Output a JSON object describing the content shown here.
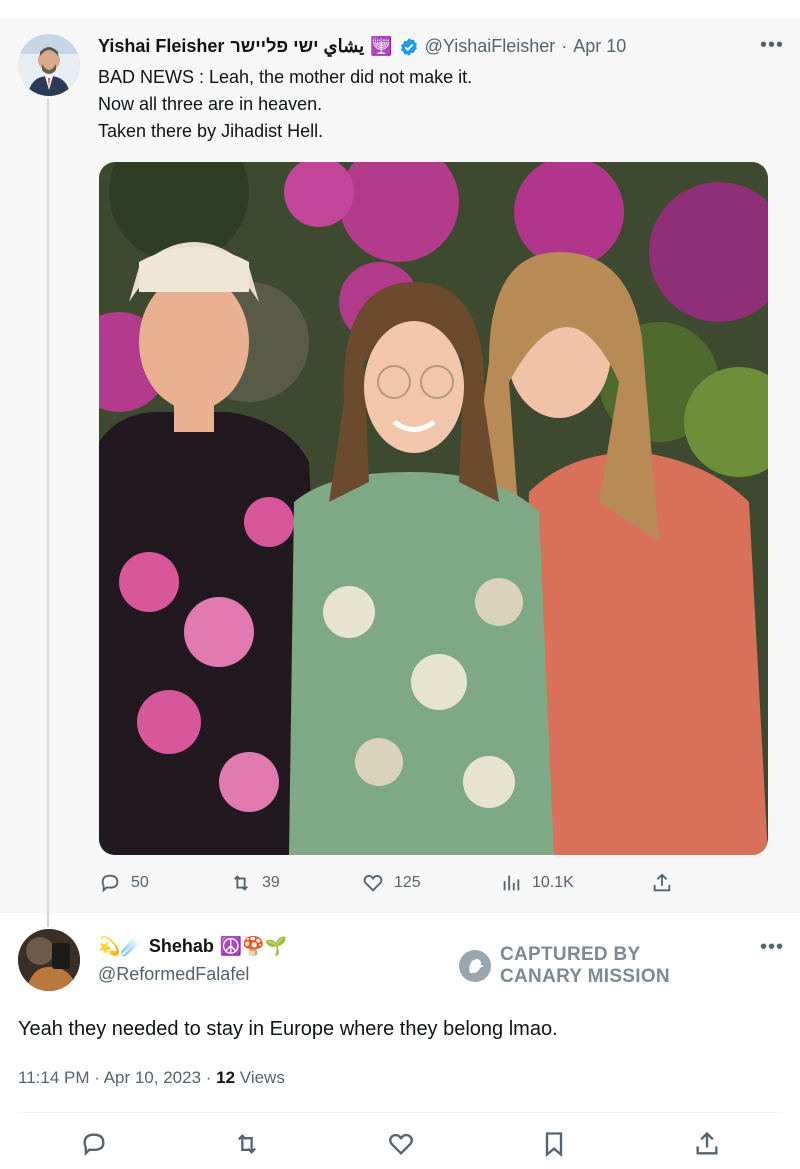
{
  "original_tweet": {
    "author_name": "Yishai Fleisher",
    "author_alt_names": "يشاي ישי פליישר",
    "author_emoji": "🕎",
    "handle": "@YishaiFleisher",
    "date": "Apr 10",
    "text_lines": [
      "BAD NEWS : Leah, the mother did not make it.",
      "Now all three are in heaven.",
      "Taken there by Jihadist Hell."
    ],
    "stats": {
      "replies": "50",
      "retweets": "39",
      "likes": "125",
      "views": "10.1K"
    }
  },
  "reply_tweet": {
    "name_prefix_emoji": "💫☄️",
    "author_name": "Shehab",
    "name_suffix_emoji": "☮️🍄🌱",
    "handle": "@ReformedFalafel",
    "text": "Yeah they needed to stay in Europe where they belong lmao.",
    "time": "11:14 PM · Apr 10, 2023 · ",
    "views_count": "12",
    "views_label": " Views"
  },
  "watermark": {
    "line1": "CAPTURED BY",
    "line2": "CANARY MISSION"
  },
  "icons": {
    "verified": "verified-badge-icon",
    "reply": "reply-icon",
    "retweet": "retweet-icon",
    "like": "heart-icon",
    "views": "views-icon",
    "share": "share-icon",
    "bookmark": "bookmark-icon",
    "more": "more-icon"
  },
  "colors": {
    "verified_blue": "#1d9bf0",
    "muted_text": "#536471",
    "primary_text": "#0f1419",
    "top_tweet_bg": "#f7f7f7"
  }
}
